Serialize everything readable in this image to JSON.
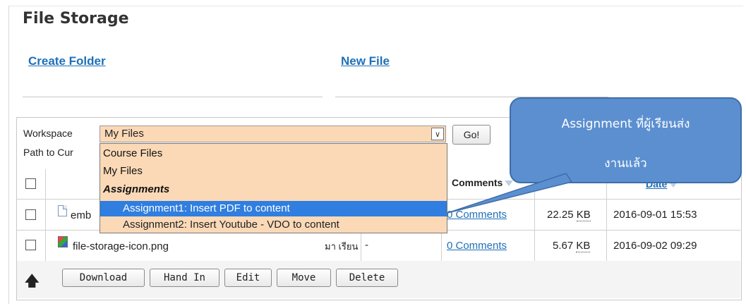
{
  "page": {
    "title": "File Storage"
  },
  "actions": {
    "create_folder": "Create Folder",
    "new_file": "New File"
  },
  "workspace": {
    "label": "Workspace",
    "selected": "My Files",
    "go_label": "Go!",
    "path_label": "Path to Cur",
    "options": [
      "Course Files",
      "My Files"
    ],
    "group_label": "Assignments",
    "group_options": [
      "Assignment1: Insert PDF to content",
      "Assignment2: Insert Youtube - VDO to content"
    ]
  },
  "table": {
    "headers": {
      "comments": "Comments",
      "date": "Date"
    },
    "rows": [
      {
        "name": "emb",
        "comments": "0 Comments",
        "size": "22.25",
        "unit": "KB",
        "date": "2016-09-01 15:53"
      },
      {
        "name": "file-storage-icon.png",
        "owner": "มา เรียน",
        "hand_in": "-",
        "comments": "0 Comments",
        "size": "5.67",
        "unit": "KB",
        "date": "2016-09-02 09:29"
      }
    ]
  },
  "buttons": {
    "download": "Download",
    "hand_in": "Hand In",
    "edit": "Edit",
    "move": "Move",
    "delete": "Delete"
  },
  "callout": {
    "line1": "Assignment ที่ผู้เรียนส่ง",
    "line2": "งานแล้ว"
  },
  "colors": {
    "link": "#1e6fb8",
    "select_bg": "#fbd9b7",
    "highlight": "#2f7ee0",
    "callout": "#5b8fd0"
  }
}
